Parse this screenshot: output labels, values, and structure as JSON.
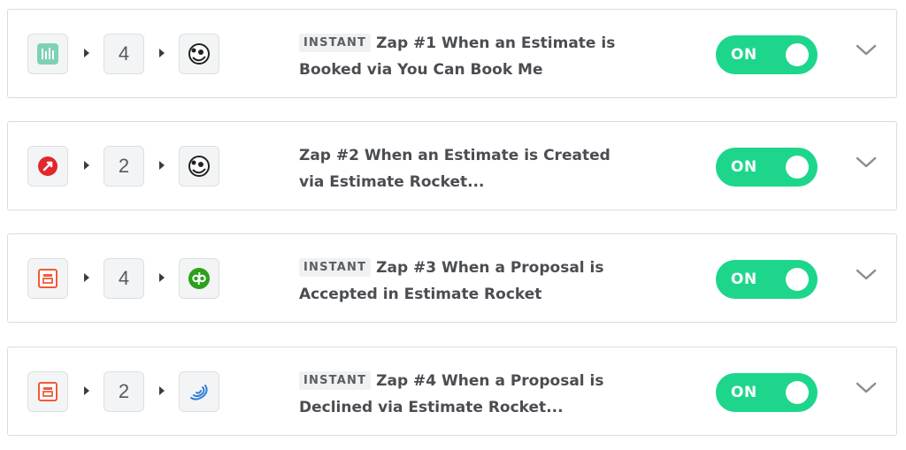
{
  "zaps": [
    {
      "trigger_icon": "youcanbookme-icon",
      "step_count": "4",
      "action_icon": "mailchimp-icon",
      "instant_badge": "INSTANT",
      "title_line1": "Zap #1 When an Estimate is",
      "title_line2": "Booked via You Can Book Me",
      "toggle_label": "ON"
    },
    {
      "trigger_icon": "estimate-rocket-icon",
      "step_count": "2",
      "action_icon": "mailchimp-icon",
      "instant_badge": "",
      "title_line1": "Zap #2 When an Estimate is Created",
      "title_line2": "via Estimate Rocket...",
      "toggle_label": "ON"
    },
    {
      "trigger_icon": "estimate-rocket-webhook-icon",
      "step_count": "4",
      "action_icon": "quickbooks-icon",
      "instant_badge": "INSTANT",
      "title_line1": "Zap #3 When a Proposal is",
      "title_line2": "Accepted in Estimate Rocket",
      "toggle_label": "ON"
    },
    {
      "trigger_icon": "estimate-rocket-webhook-icon",
      "step_count": "2",
      "action_icon": "swirl-app-icon",
      "instant_badge": "INSTANT",
      "title_line1": "Zap #4 When a Proposal is",
      "title_line2": "Declined via Estimate Rocket...",
      "toggle_label": "ON"
    }
  ],
  "colors": {
    "toggle_on": "#1dd68c",
    "text": "#4a4d51",
    "border": "#d9dde0"
  }
}
